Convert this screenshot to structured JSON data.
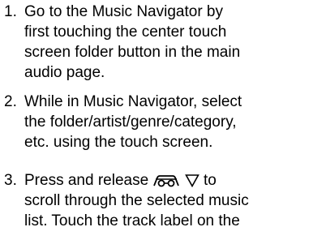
{
  "instructions": {
    "steps": [
      {
        "number": "1.",
        "lines": [
          "Go to the Music Navigator by",
          "first touching the center touch",
          "screen folder button in the main",
          "audio page."
        ]
      },
      {
        "number": "2.",
        "lines": [
          "While in Music Navigator, select",
          "the folder/artist/genre/category,",
          "etc. using the touch screen."
        ]
      },
      {
        "number": "3.",
        "line1_before": "Press and release ",
        "line1_after": " to",
        "lines_rest": [
          "scroll through the selected music",
          "list. Touch the track label on the"
        ],
        "icons": [
          "steering-wheel-control-icon",
          "down-triangle-icon"
        ]
      }
    ]
  }
}
